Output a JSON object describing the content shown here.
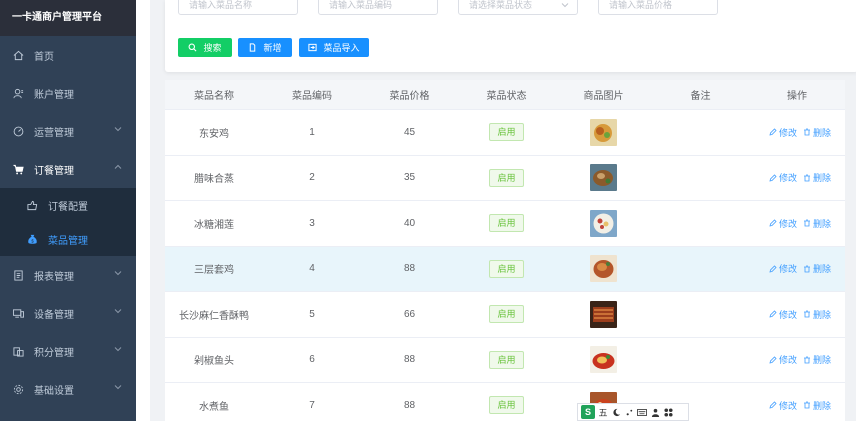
{
  "sidebar": {
    "brand": "一卡通商户管理平台",
    "items": [
      {
        "label": "首页",
        "icon": "home-icon"
      },
      {
        "label": "账户管理",
        "icon": "user-icon"
      },
      {
        "label": "运营管理",
        "icon": "dashboard-icon"
      },
      {
        "label": "订餐管理",
        "icon": "cart-icon"
      },
      {
        "label": "报表管理",
        "icon": "report-icon"
      },
      {
        "label": "设备管理",
        "icon": "device-icon"
      },
      {
        "label": "积分管理",
        "icon": "points-icon"
      },
      {
        "label": "基础设置",
        "icon": "settings-icon"
      }
    ],
    "submenu": [
      {
        "label": "订餐配置",
        "icon": "config-icon"
      },
      {
        "label": "菜品管理",
        "icon": "money-bag-icon"
      }
    ]
  },
  "search": {
    "name_placeholder": "请输入菜品名称",
    "code_placeholder": "请输入菜品编码",
    "status_placeholder": "请选择菜品状态",
    "price_placeholder": "请输入菜品价格"
  },
  "buttons": {
    "search": "搜索",
    "add": "新增",
    "import": "菜品导入"
  },
  "table": {
    "headers": [
      "菜品名称",
      "菜品编码",
      "菜品价格",
      "菜品状态",
      "商品图片",
      "备注",
      "操作"
    ],
    "rows": [
      {
        "name": "东安鸡",
        "code": "1",
        "price": "45",
        "status": "启用",
        "remark": ""
      },
      {
        "name": "腊味合蒸",
        "code": "2",
        "price": "35",
        "status": "启用",
        "remark": ""
      },
      {
        "name": "冰糖湘莲",
        "code": "3",
        "price": "40",
        "status": "启用",
        "remark": ""
      },
      {
        "name": "三层套鸡",
        "code": "4",
        "price": "88",
        "status": "启用",
        "remark": ""
      },
      {
        "name": "长沙麻仁香酥鸭",
        "code": "5",
        "price": "66",
        "status": "启用",
        "remark": ""
      },
      {
        "name": "剁椒鱼头",
        "code": "6",
        "price": "88",
        "status": "启用",
        "remark": ""
      },
      {
        "name": "水煮鱼",
        "code": "7",
        "price": "88",
        "status": "启用",
        "remark": ""
      }
    ],
    "edit_label": "修改",
    "delete_label": "删除"
  },
  "ime": {
    "mode": "五"
  },
  "colors": {
    "sidebar": "#304156",
    "active": "#409eff",
    "green": "#13ce66",
    "blue": "#1890ff",
    "highlight_row": "#e8f5fb"
  }
}
